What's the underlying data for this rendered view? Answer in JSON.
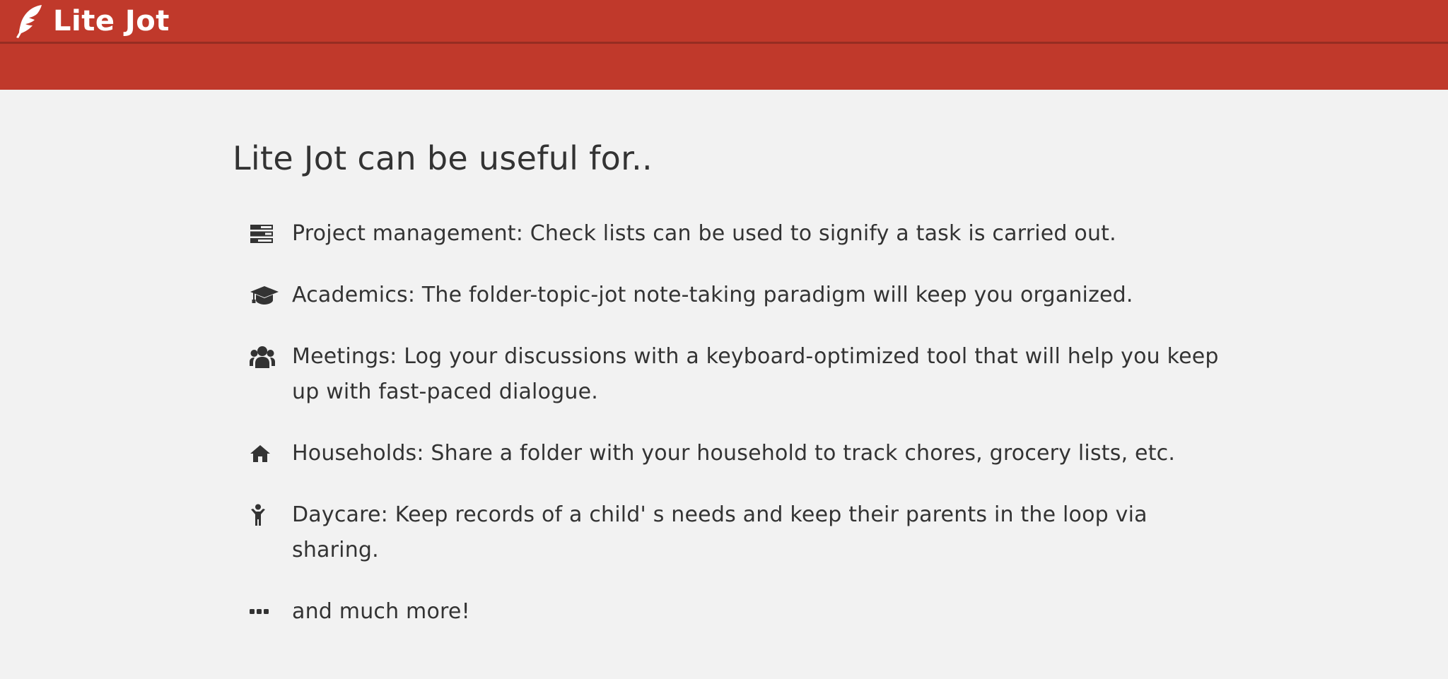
{
  "header": {
    "brand_name": "Lite Jot",
    "logo_icon": "feather-icon",
    "bar_color": "#c0392b"
  },
  "main": {
    "heading": "Lite Jot can be useful for..",
    "items": [
      {
        "icon": "tasks-icon",
        "text": "Project management: Check lists can be used to signify a task is carried out."
      },
      {
        "icon": "graduation-cap-icon",
        "text": "Academics: The folder-topic-jot note-taking paradigm will keep you organized."
      },
      {
        "icon": "users-icon",
        "text": "Meetings: Log your discussions with a keyboard-optimized tool that will help you keep up with fast-paced dialogue."
      },
      {
        "icon": "home-icon",
        "text": "Households: Share a folder with your household to track chores, grocery lists, etc."
      },
      {
        "icon": "child-icon",
        "text": "Daycare: Keep records of a child' s needs and keep their parents in the loop via sharing."
      },
      {
        "icon": "ellipsis-icon",
        "text": "and much more!"
      }
    ]
  },
  "colors": {
    "background": "#f2f2f2",
    "text": "#333333",
    "accent": "#c0392b"
  }
}
